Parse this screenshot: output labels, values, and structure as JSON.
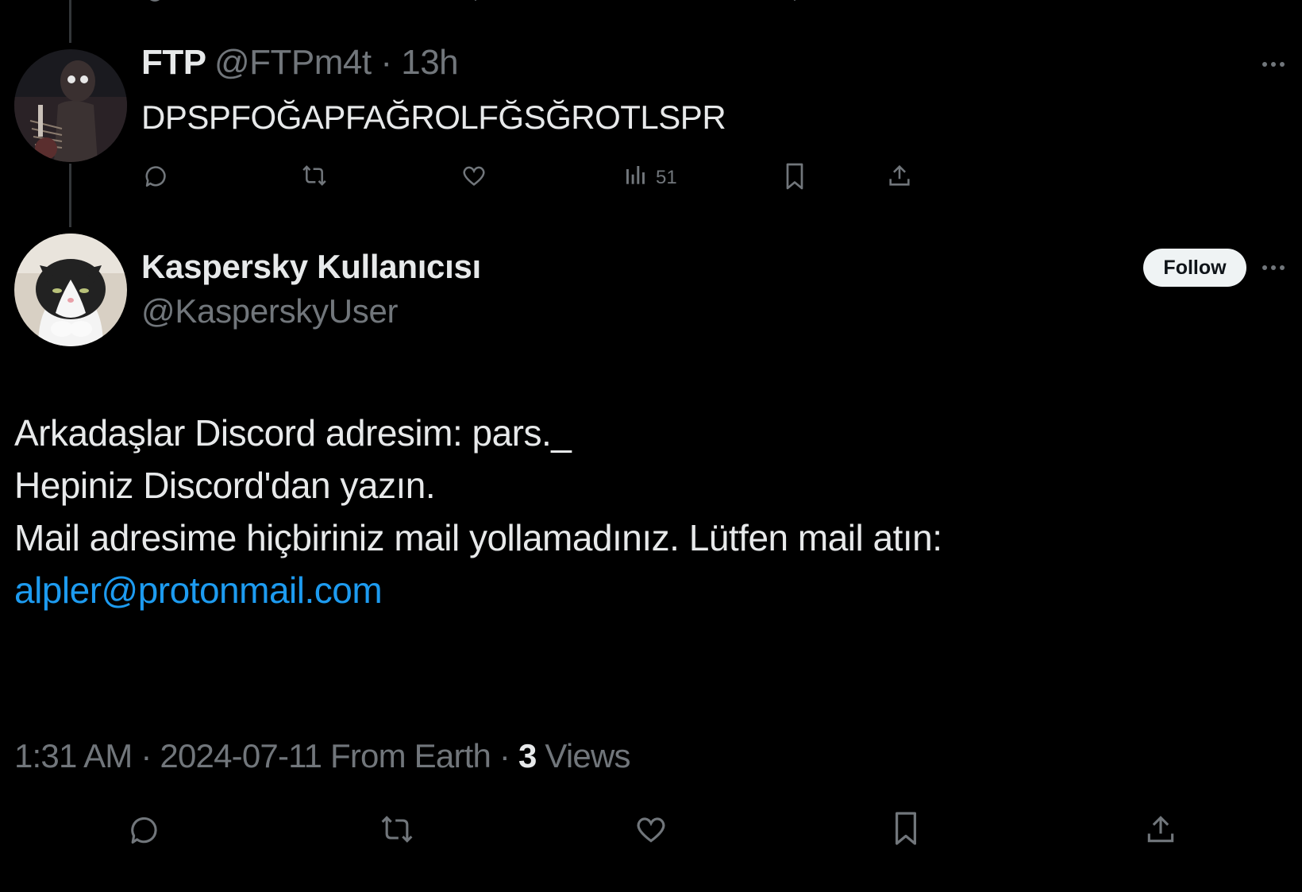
{
  "previous_tweet": {
    "author_name": "FTP",
    "handle_time": "@FTPm4t · 13h",
    "text": "DPSPFOĞAPFAĞROLFĞSĞROTLSPR",
    "views": "51"
  },
  "main_tweet": {
    "author_name": "Kaspersky Kullanıcısı",
    "handle": "@KasperskyUser",
    "follow_label": "Follow",
    "lines": [
      "Arkadaşlar Discord adresim: pars._",
      "Hepiniz Discord'dan yazın.",
      "Mail adresime hiçbiriniz mail yollamadınız. Lütfen mail atın:"
    ],
    "email": "alpler@protonmail.com",
    "meta_prefix": "1:31 AM · 2024-07-11 From Earth · ",
    "views_count": "3",
    "views_suffix": " Views"
  },
  "colors": {
    "background": "#000000",
    "text": "#e7e9ea",
    "muted": "#71767b",
    "link": "#1d9bf0"
  }
}
